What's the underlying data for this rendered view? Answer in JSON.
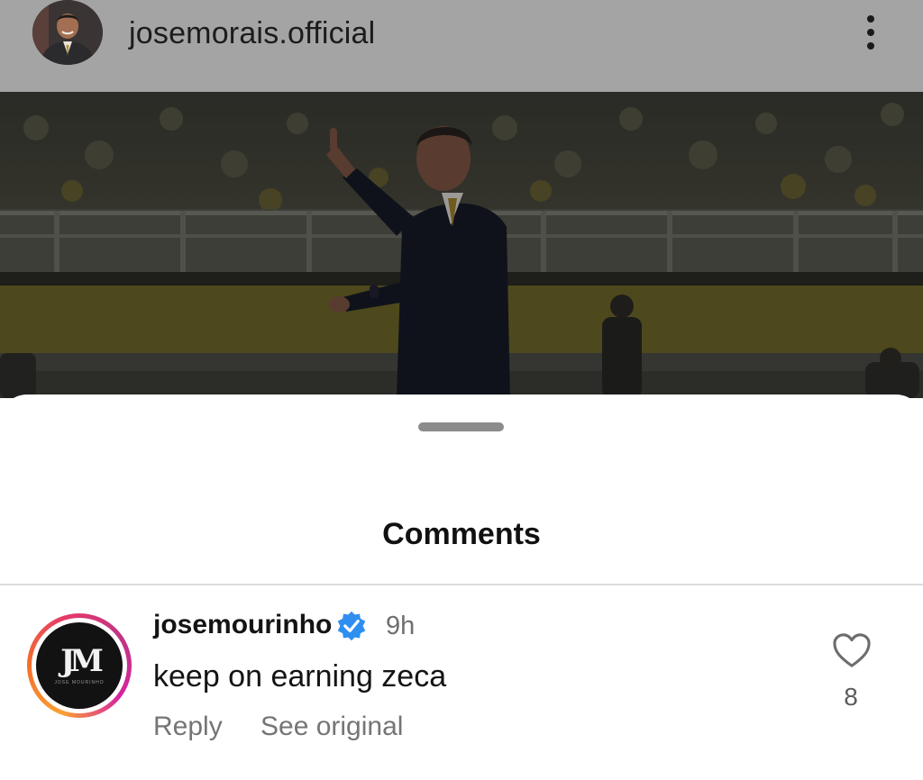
{
  "header": {
    "username": "josemorais.official",
    "avatar_icon": "profile-photo",
    "more_icon": "vertical-ellipsis-icon"
  },
  "post": {
    "image_subject": "coach pointing on stadium sideline",
    "overlay_color": "#000000"
  },
  "comments_sheet": {
    "title": "Comments",
    "comments": [
      {
        "username": "josemourinho",
        "verified": true,
        "time": "9h",
        "text": "keep on earning zeca",
        "actions": [
          "Reply",
          "See original"
        ],
        "like_count": "8",
        "avatar_mark": "JM",
        "avatar_subtext": "JOSE MOURINHO"
      }
    ]
  },
  "colors": {
    "verified_badge": "#2f8ff0",
    "muted_text": "#757575",
    "story_ring_start": "#f9a134",
    "story_ring_end": "#c13584"
  }
}
